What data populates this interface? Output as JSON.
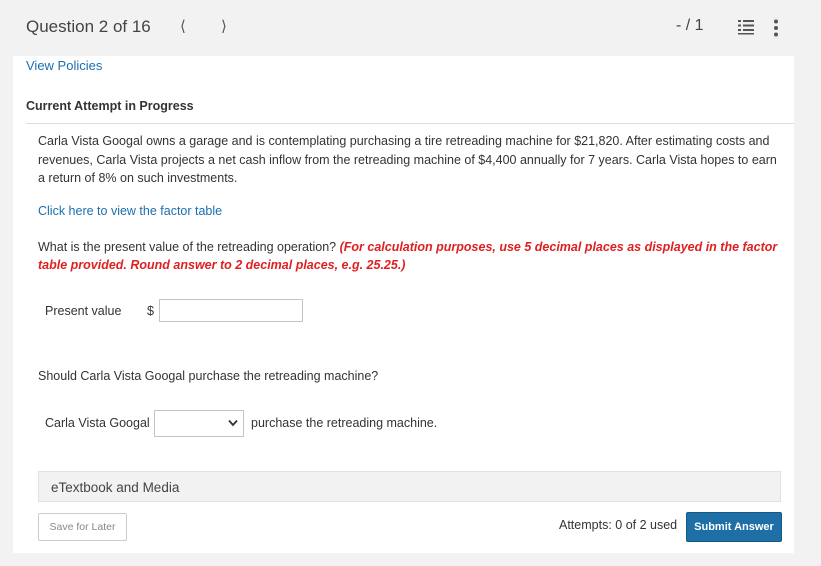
{
  "header": {
    "question_label": "Question 2 of 16",
    "prev_icon": "chevron-left-icon",
    "next_icon": "chevron-right-icon",
    "score": "- / 1",
    "list_icon": "list-icon",
    "more_icon": "more-vertical-icon"
  },
  "links": {
    "view_policies": "View Policies",
    "factor_table": "Click here to view the factor table"
  },
  "attempt_heading": "Current Attempt in Progress",
  "problem_text": "Carla Vista Googal owns a garage and is contemplating purchasing a tire retreading machine for $21,820. After estimating costs and revenues, Carla Vista projects a net cash inflow from the retreading machine of $4,400 annually for 7 years. Carla Vista hopes to earn a return of 8% on such investments.",
  "question1": {
    "text": "What is the present value of the retreading operation?",
    "hint": "(For calculation purposes, use 5 decimal places as displayed in the factor table provided. Round answer to 2 decimal places, e.g. 25.25.)"
  },
  "present_value": {
    "label": "Present value",
    "currency": "$",
    "value": ""
  },
  "question2": {
    "text": "Should Carla Vista Googal purchase the retreading machine?"
  },
  "decision": {
    "prefix": "Carla Vista Googal",
    "selected": "",
    "suffix": "purchase the retreading machine."
  },
  "etextbook_label": "eTextbook and Media",
  "footer": {
    "save_label": "Save for Later",
    "attempts_text": "Attempts: 0 of 2 used",
    "submit_label": "Submit Answer"
  },
  "colors": {
    "link": "#1a6fb0",
    "hint": "#e02020",
    "submit": "#1d6fa5"
  }
}
